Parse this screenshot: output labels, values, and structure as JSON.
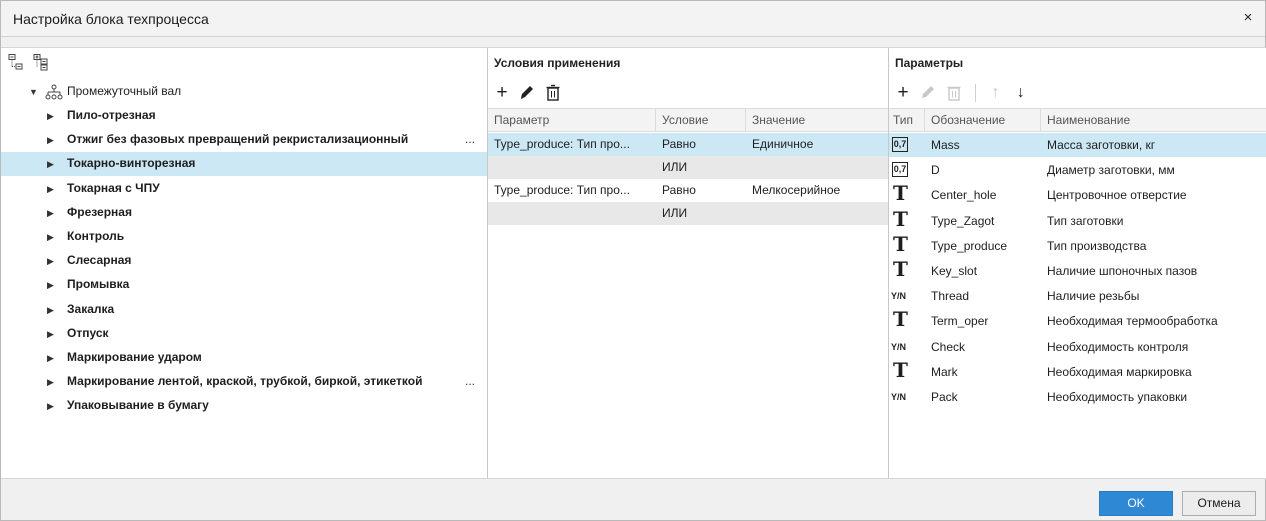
{
  "window": {
    "title": "Настройка блока техпроцесса",
    "close_glyph": "×"
  },
  "tree": {
    "root_label": "Промежуточный вал",
    "items": [
      {
        "label": "Пило-отрезная",
        "selected": false,
        "truncated": false
      },
      {
        "label": "Отжиг без фазовых превращений рекристализационный",
        "selected": false,
        "truncated": true
      },
      {
        "label": "Токарно-винторезная",
        "selected": true,
        "truncated": false
      },
      {
        "label": "Токарная с ЧПУ",
        "selected": false,
        "truncated": false
      },
      {
        "label": "Фрезерная",
        "selected": false,
        "truncated": false
      },
      {
        "label": "Контроль",
        "selected": false,
        "truncated": false
      },
      {
        "label": "Слесарная",
        "selected": false,
        "truncated": false
      },
      {
        "label": "Промывка",
        "selected": false,
        "truncated": false
      },
      {
        "label": "Закалка",
        "selected": false,
        "truncated": false
      },
      {
        "label": "Отпуск",
        "selected": false,
        "truncated": false
      },
      {
        "label": "Маркирование ударом",
        "selected": false,
        "truncated": false
      },
      {
        "label": "Маркирование лентой, краской, трубкой, биркой, этикеткой",
        "selected": false,
        "truncated": true
      },
      {
        "label": "Упаковывание в бумагу",
        "selected": false,
        "truncated": false
      }
    ],
    "ellipsis": "..."
  },
  "conditions": {
    "title": "Условия применения",
    "columns": {
      "param": "Параметр",
      "cond": "Условие",
      "value": "Значение"
    },
    "rows": [
      {
        "param": "Type_produce: Тип про...",
        "cond": "Равно",
        "value": "Единичное"
      },
      {
        "or": "ИЛИ"
      },
      {
        "param": "Type_produce: Тип про...",
        "cond": "Равно",
        "value": "Мелкосерийное"
      },
      {
        "or": "ИЛИ"
      }
    ]
  },
  "parameters": {
    "title": "Параметры",
    "columns": {
      "type": "Тип",
      "code": "Обозначение",
      "name": "Наименование"
    },
    "type_glyphs": {
      "num": "0,7",
      "text": "T",
      "bool": "Y/N"
    },
    "rows": [
      {
        "type": "num",
        "code": "Mass",
        "name": "Масса заготовки, кг"
      },
      {
        "type": "num",
        "code": "D",
        "name": "Диаметр заготовки, мм"
      },
      {
        "type": "text",
        "code": "Center_hole",
        "name": "Центровочное отверстие"
      },
      {
        "type": "text",
        "code": "Type_Zagot",
        "name": "Тип заготовки"
      },
      {
        "type": "text",
        "code": "Type_produce",
        "name": "Тип производства"
      },
      {
        "type": "text",
        "code": "Key_slot",
        "name": "Наличие шпоночных пазов"
      },
      {
        "type": "bool",
        "code": "Thread",
        "name": "Наличие резьбы"
      },
      {
        "type": "text",
        "code": "Term_oper",
        "name": "Необходимая термообработка"
      },
      {
        "type": "bool",
        "code": "Check",
        "name": "Необходимость контроля"
      },
      {
        "type": "text",
        "code": "Mark",
        "name": "Необходимая маркировка"
      },
      {
        "type": "bool",
        "code": "Pack",
        "name": "Необходимость упаковки"
      }
    ]
  },
  "toolbar": {
    "add": "+",
    "up": "↑",
    "down": "↓"
  },
  "buttons": {
    "ok": "OK",
    "cancel": "Отмена"
  },
  "colors": {
    "selection": "#cce8f4",
    "accent": "#2f88d4",
    "or_row": "#e8e8e8"
  }
}
